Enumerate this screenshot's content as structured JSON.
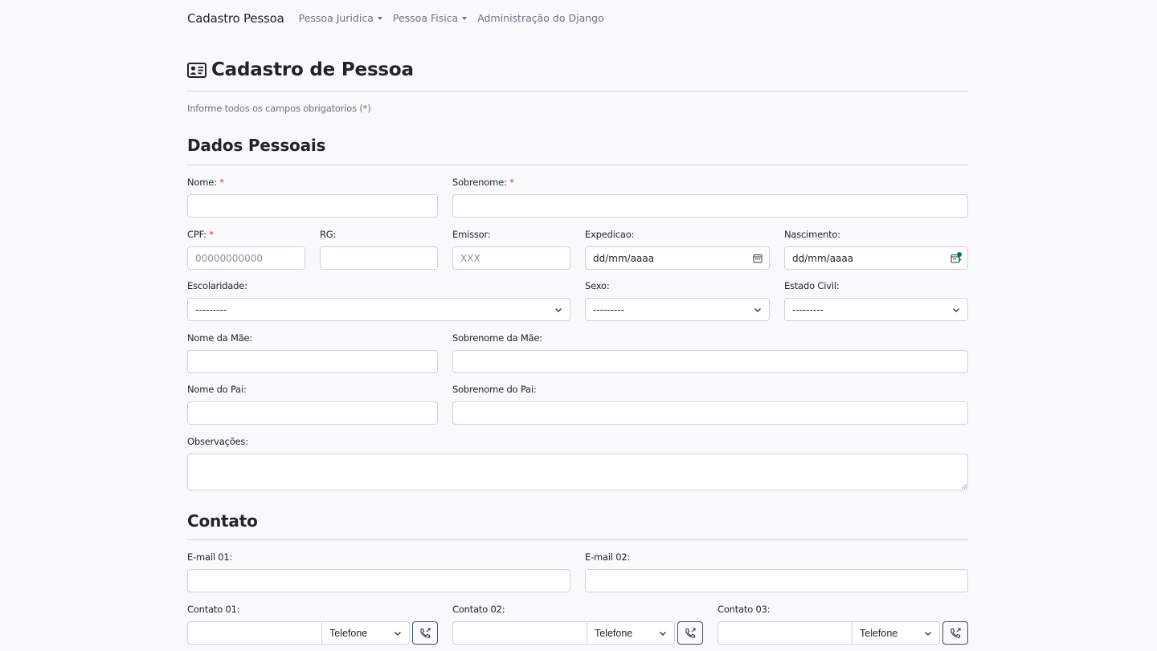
{
  "nav": {
    "brand": "Cadastro Pessoa",
    "items": [
      {
        "label": "Pessoa Juridica",
        "dropdown": true
      },
      {
        "label": "Pessoa Fisica",
        "dropdown": true
      },
      {
        "label": "Administração do Django",
        "dropdown": false
      }
    ]
  },
  "page": {
    "title": "Cadastro de Pessoa",
    "hint_text": "Informe todos os campos obrigatorios (",
    "hint_star": "*",
    "hint_close": ")"
  },
  "dados": {
    "heading": "Dados Pessoais",
    "nome": {
      "label": "Nome:",
      "required": "*",
      "value": ""
    },
    "sobrenome": {
      "label": "Sobrenome:",
      "required": "*",
      "value": ""
    },
    "cpf": {
      "label": "CPF:",
      "required": "*",
      "placeholder": "00000000000"
    },
    "rg": {
      "label": "RG:",
      "value": ""
    },
    "emissor": {
      "label": "Emissor:",
      "placeholder": "XXX"
    },
    "expedicao": {
      "label": "Expedicao:",
      "value": "dd/mm/aaaa"
    },
    "nascimento": {
      "label": "Nascimento:",
      "value": "dd/mm/aaaa"
    },
    "escolaridade": {
      "label": "Escolaridade:",
      "selected": "---------"
    },
    "sexo": {
      "label": "Sexo:",
      "selected": "---------"
    },
    "estado_civil": {
      "label": "Estado Civil:",
      "selected": "---------"
    },
    "nome_mae": {
      "label": "Nome da Mãe:",
      "value": ""
    },
    "sobrenome_mae": {
      "label": "Sobrenome da Mãe:",
      "value": ""
    },
    "nome_pai": {
      "label": "Nome do Pai:",
      "value": ""
    },
    "sobrenome_pai": {
      "label": "Sobrenome do Pai:",
      "value": ""
    },
    "observacoes": {
      "label": "Observações:",
      "value": ""
    }
  },
  "contato": {
    "heading": "Contato",
    "email1": {
      "label": "E-mail 01:",
      "value": ""
    },
    "email2": {
      "label": "E-mail 02:",
      "value": ""
    },
    "contatos": [
      {
        "label": "Contato 01:",
        "type": "Telefone"
      },
      {
        "label": "Contato 02:",
        "type": "Telefone"
      },
      {
        "label": "Contato 03:",
        "type": "Telefone"
      }
    ]
  },
  "colors": {
    "accent": "#0d6e5c",
    "required": "#dc3545",
    "muted": "#6c757d"
  }
}
